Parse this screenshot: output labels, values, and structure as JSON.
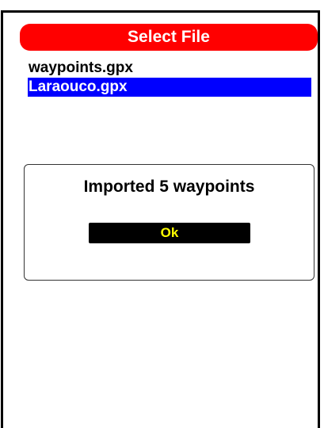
{
  "header": {
    "title": "Select File",
    "accent_color": "#ff0000"
  },
  "file_list": {
    "items": [
      {
        "label": "waypoints.gpx",
        "selected": false
      },
      {
        "label": "Laraouco.gpx",
        "selected": true
      }
    ],
    "selection_color": "#0000ff"
  },
  "dialog": {
    "message": "Imported 5 waypoints",
    "ok_label": "Ok",
    "ok_text_color": "#ffff00"
  }
}
